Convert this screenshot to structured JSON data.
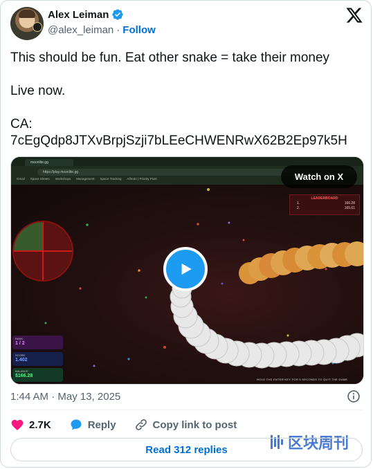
{
  "header": {
    "author_name": "Alex Leiman",
    "handle": "@alex_leiman",
    "separator": "·",
    "follow_label": "Follow"
  },
  "tweet": {
    "line1": "This should be fun. Eat other snake = take their money",
    "line2": "Live now.",
    "line3": "CA:",
    "line4": "7cEgQdp8JTXvBrpjSzji7bLEeCHWENRwX62B2Ep97k5H"
  },
  "media": {
    "watch_label": "Watch on X",
    "browser_tab": "moonlite.gg",
    "url": "https://play.moonlite.gg",
    "bookmarks": [
      "Gmail",
      "Space Sheets",
      "Workshops",
      "Management",
      "Space Tracking",
      "Alfredo | Priority Pixel"
    ],
    "leaderboard": {
      "title": "LEADERBOARD",
      "rows": [
        {
          "rank": "1.",
          "value": "166.28"
        },
        {
          "rank": "2.",
          "value": "165.61"
        }
      ]
    },
    "stats": {
      "rank_label": "RANK",
      "rank_value": "1 / 2",
      "score_label": "SCORE",
      "score_value": "1.402",
      "balance_label": "BALANCE",
      "balance_value": "$166.28"
    },
    "hint": "HOLD THE ENTER KEY FOR 5 SECONDS TO QUIT THE GAME"
  },
  "meta": {
    "timestamp": "1:44 AM · May 13, 2025"
  },
  "actions": {
    "like_count": "2.7K",
    "reply_label": "Reply",
    "copy_label": "Copy link to post"
  },
  "read_replies_label": "Read 312 replies",
  "watermark_text": "区块周刊",
  "colors": {
    "link_blue": "#006fd6",
    "play_blue": "#1d9bf0",
    "like_pink": "#f91880",
    "secondary_text": "#536471"
  }
}
